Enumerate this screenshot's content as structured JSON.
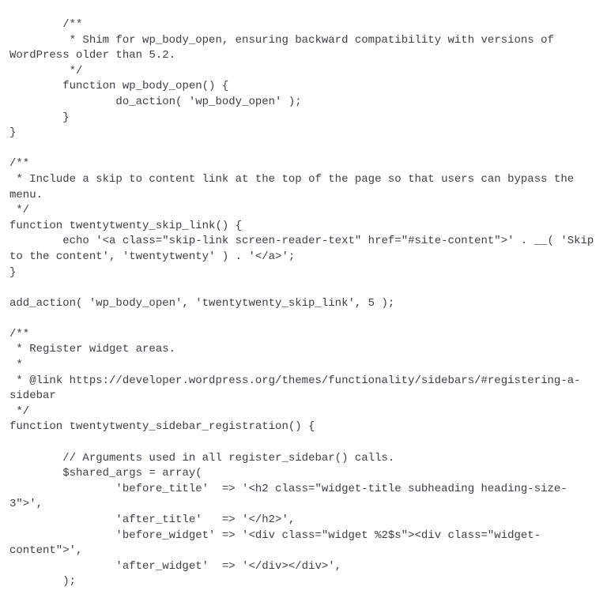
{
  "code": "        /**\n         * Shim for wp_body_open, ensuring backward compatibility with versions of WordPress older than 5.2.\n         */\n        function wp_body_open() {\n                do_action( 'wp_body_open' );\n        }\n}\n\n/**\n * Include a skip to content link at the top of the page so that users can bypass the menu.\n */\nfunction twentytwenty_skip_link() {\n        echo '<a class=\"skip-link screen-reader-text\" href=\"#site-content\">' . __( 'Skip to the content', 'twentytwenty' ) . '</a>';\n}\n\nadd_action( 'wp_body_open', 'twentytwenty_skip_link', 5 );\n\n/**\n * Register widget areas.\n *\n * @link https://developer.wordpress.org/themes/functionality/sidebars/#registering-a-sidebar\n */\nfunction twentytwenty_sidebar_registration() {\n\n        // Arguments used in all register_sidebar() calls.\n        $shared_args = array(\n                'before_title'  => '<h2 class=\"widget-title subheading heading-size-3\">',\n                'after_title'   => '</h2>',\n                'before_widget' => '<div class=\"widget %2$s\"><div class=\"widget-content\">',\n                'after_widget'  => '</div></div>',\n        );"
}
